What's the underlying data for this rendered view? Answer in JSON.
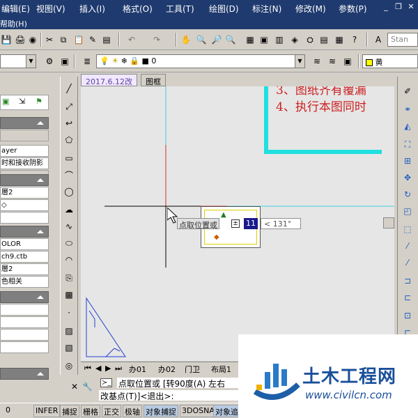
{
  "menu": [
    "编辑(E)",
    "视图(V)",
    "插入(I)",
    "格式(O)",
    "工具(T)",
    "绘图(D)",
    "标注(N)",
    "修改(M)",
    "参数(P)"
  ],
  "help_menu": "帮助(H)",
  "toolbar": {
    "style_combo": "Stan",
    "layer_combo": "0",
    "color_combo": "黄"
  },
  "doc_tabs": [
    "2017.6.12改",
    "图框"
  ],
  "left_panel": {
    "rows": [
      "ayer",
      "时和接收阴影",
      "層2",
      "◇",
      "OLOR",
      "ch9.ctb",
      "層2",
      "色相关"
    ]
  },
  "drawing": {
    "notes": [
      "3、图纸齐有覆漏",
      "4、执行本图同时"
    ],
    "tooltip_prompt": "点取位置或",
    "tooltip_value": "11",
    "tooltip_angle": "< 131°"
  },
  "layout_tabs": [
    "办01",
    "办02",
    "门卫",
    "布局1"
  ],
  "command": {
    "line1": "点取位置或 [转90度(A) 左右",
    "line2": "改基点(T)]<退出>:"
  },
  "status": {
    "coords_tail": "0",
    "buttons": [
      "INFER",
      "捕捉",
      "栅格",
      "正交",
      "极轴",
      "对象捕捉",
      "3DOSNAP",
      "对象追"
    ]
  },
  "watermark": {
    "brand": "土木工程网",
    "url": "www.civilcn.com"
  },
  "colors": {
    "menu_bg": "#1f3a6e",
    "canvas_bg": "#e6e6e6",
    "note_red": "#cc2020",
    "frame_cyan": "#20e0e0",
    "axis_red": "#d03030",
    "axis_cyan": "#40d0e0",
    "triangle_blue": "#2040d0"
  }
}
